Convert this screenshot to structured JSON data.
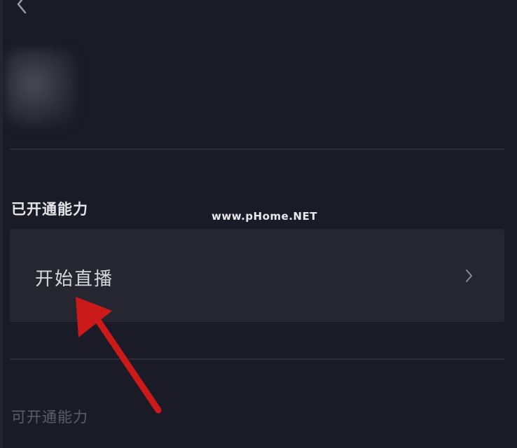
{
  "header": {
    "back_icon": "chevron-left-icon"
  },
  "profile": {
    "avatar": "blurred"
  },
  "sections": {
    "enabled_title": "已开通能力",
    "enabled_items": [
      {
        "label": "开始直播",
        "icon": "chevron-right-icon"
      }
    ],
    "available_title": "可开通能力"
  },
  "watermark": "www.pHome.NET",
  "annotation": {
    "type": "red-arrow",
    "color": "#cc1a1a",
    "points_to": "开始直播"
  },
  "colors": {
    "background": "#1a1b26",
    "row_background": "#25262f",
    "divider": "#2b2c37",
    "text_primary": "#e6e6ea",
    "text_muted": "#5d5e68"
  }
}
